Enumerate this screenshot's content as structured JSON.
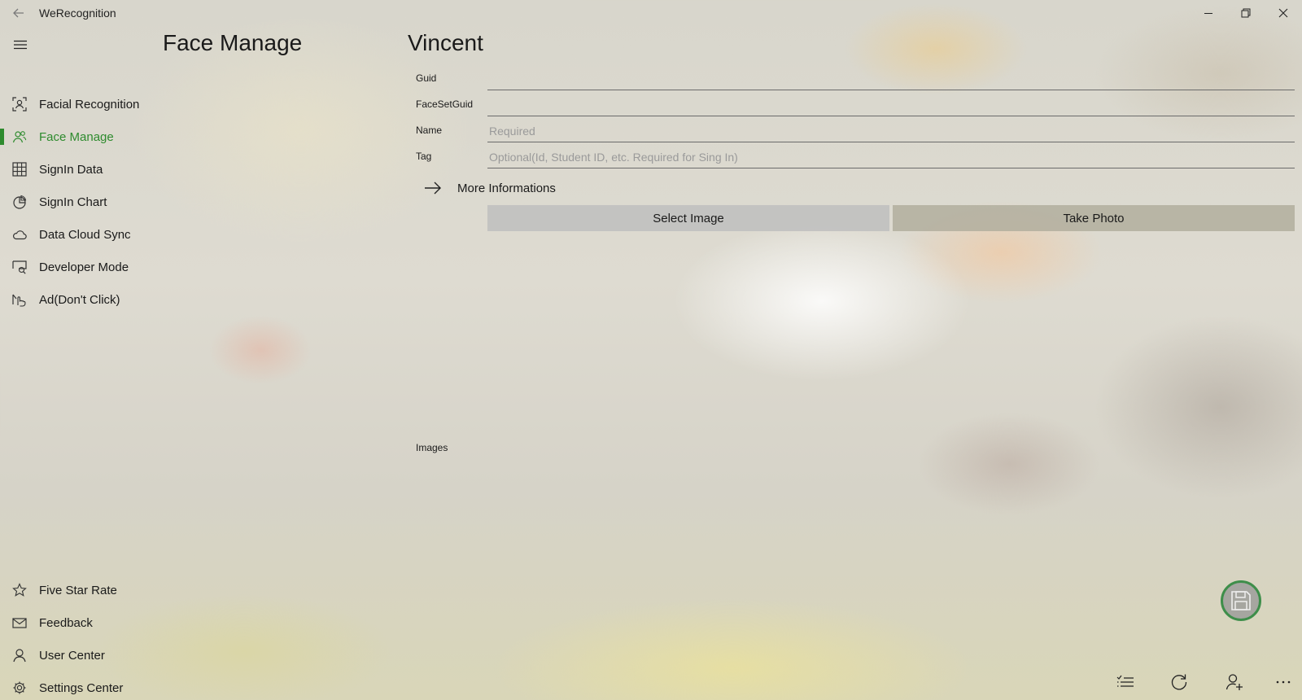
{
  "window": {
    "title": "WeRecognition"
  },
  "sidebar": {
    "items": [
      {
        "label": "Facial Recognition",
        "icon": "face-scan-icon"
      },
      {
        "label": "Face Manage",
        "icon": "people-icon",
        "active": true
      },
      {
        "label": "SignIn Data",
        "icon": "grid-icon"
      },
      {
        "label": "SignIn Chart",
        "icon": "pie-chart-icon"
      },
      {
        "label": "Data Cloud Sync",
        "icon": "cloud-icon"
      },
      {
        "label": "Developer Mode",
        "icon": "developer-icon"
      },
      {
        "label": "Ad(Don't Click)",
        "icon": "ad-icon"
      }
    ],
    "bottom_items": [
      {
        "label": "Five Star Rate",
        "icon": "star-icon"
      },
      {
        "label": "Feedback",
        "icon": "mail-icon"
      },
      {
        "label": "User Center",
        "icon": "user-icon"
      },
      {
        "label": "Settings Center",
        "icon": "gear-icon"
      }
    ],
    "accent_color": "#2e8b2e"
  },
  "page": {
    "title": "Face Manage"
  },
  "form": {
    "person_name": "Vincent",
    "fields": [
      {
        "label": "Guid",
        "value": "",
        "placeholder": ""
      },
      {
        "label": "FaceSetGuid",
        "value": "",
        "placeholder": ""
      },
      {
        "label": "Name",
        "value": "",
        "placeholder": "Required"
      },
      {
        "label": "Tag",
        "value": "",
        "placeholder": "Optional(Id, Student ID, etc. Required for Sing In)"
      }
    ],
    "more_info_label": "More Informations",
    "select_image_label": "Select Image",
    "take_photo_label": "Take Photo",
    "images_label": "Images"
  },
  "command_bar": {
    "icons": [
      "checklist-icon",
      "refresh-icon",
      "add-user-icon",
      "more-icon"
    ]
  }
}
